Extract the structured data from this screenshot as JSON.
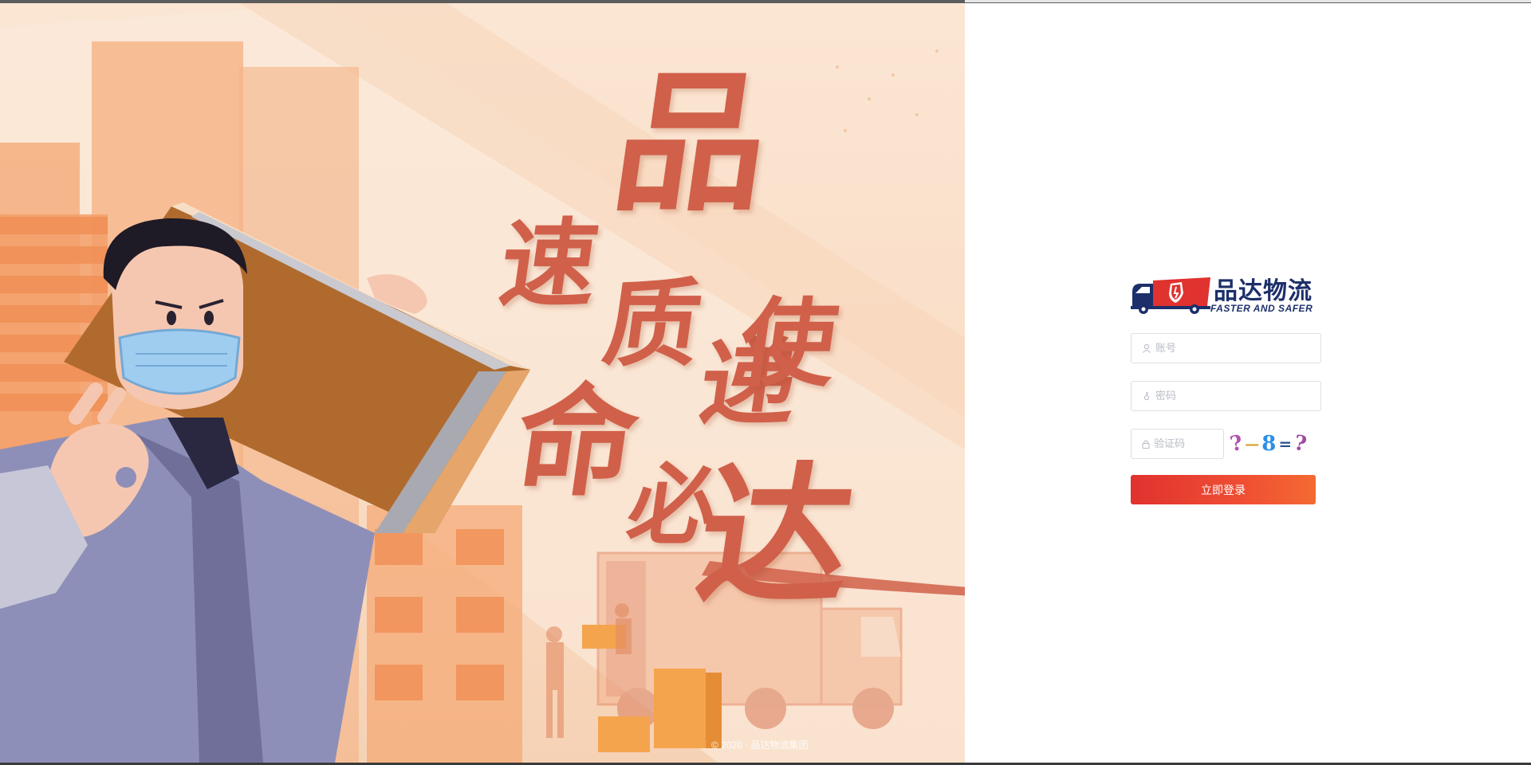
{
  "hero": {
    "slogan_chars": [
      "品",
      "速",
      "质",
      "递",
      "使",
      "命",
      "必",
      "达"
    ],
    "copyright": "© 2020 · 品达物流集团"
  },
  "login": {
    "logo": {
      "name": "品达物流",
      "tagline": "FASTER AND SAFER",
      "icon": "truck-shield-logo"
    },
    "username": {
      "placeholder": "账号",
      "icon": "user-icon"
    },
    "password": {
      "placeholder": "密码",
      "icon": "key-icon"
    },
    "captcha": {
      "placeholder": "验证码",
      "icon": "lock-icon",
      "image_chars": [
        "?",
        "—",
        "8",
        "=",
        "?"
      ],
      "image_colors": [
        "#b34fb0",
        "#d8a12a",
        "#2c8ee8",
        "#2b4f8a",
        "#a04a9f"
      ]
    },
    "submit_label": "立即登录"
  },
  "colors": {
    "accent": "#e0322f",
    "accent_end": "#f46a32",
    "calligraphy": "#d0604a",
    "brand_navy": "#1c2f6a"
  }
}
